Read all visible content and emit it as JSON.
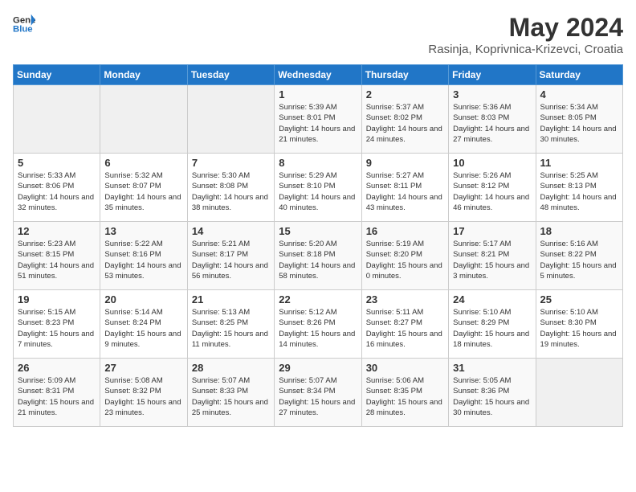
{
  "logo": {
    "general": "General",
    "blue": "Blue"
  },
  "title": "May 2024",
  "subtitle": "Rasinja, Koprivnica-Krizevci, Croatia",
  "days_of_week": [
    "Sunday",
    "Monday",
    "Tuesday",
    "Wednesday",
    "Thursday",
    "Friday",
    "Saturday"
  ],
  "weeks": [
    [
      {
        "day": "",
        "info": ""
      },
      {
        "day": "",
        "info": ""
      },
      {
        "day": "",
        "info": ""
      },
      {
        "day": "1",
        "info": "Sunrise: 5:39 AM\nSunset: 8:01 PM\nDaylight: 14 hours and 21 minutes."
      },
      {
        "day": "2",
        "info": "Sunrise: 5:37 AM\nSunset: 8:02 PM\nDaylight: 14 hours and 24 minutes."
      },
      {
        "day": "3",
        "info": "Sunrise: 5:36 AM\nSunset: 8:03 PM\nDaylight: 14 hours and 27 minutes."
      },
      {
        "day": "4",
        "info": "Sunrise: 5:34 AM\nSunset: 8:05 PM\nDaylight: 14 hours and 30 minutes."
      }
    ],
    [
      {
        "day": "5",
        "info": "Sunrise: 5:33 AM\nSunset: 8:06 PM\nDaylight: 14 hours and 32 minutes."
      },
      {
        "day": "6",
        "info": "Sunrise: 5:32 AM\nSunset: 8:07 PM\nDaylight: 14 hours and 35 minutes."
      },
      {
        "day": "7",
        "info": "Sunrise: 5:30 AM\nSunset: 8:08 PM\nDaylight: 14 hours and 38 minutes."
      },
      {
        "day": "8",
        "info": "Sunrise: 5:29 AM\nSunset: 8:10 PM\nDaylight: 14 hours and 40 minutes."
      },
      {
        "day": "9",
        "info": "Sunrise: 5:27 AM\nSunset: 8:11 PM\nDaylight: 14 hours and 43 minutes."
      },
      {
        "day": "10",
        "info": "Sunrise: 5:26 AM\nSunset: 8:12 PM\nDaylight: 14 hours and 46 minutes."
      },
      {
        "day": "11",
        "info": "Sunrise: 5:25 AM\nSunset: 8:13 PM\nDaylight: 14 hours and 48 minutes."
      }
    ],
    [
      {
        "day": "12",
        "info": "Sunrise: 5:23 AM\nSunset: 8:15 PM\nDaylight: 14 hours and 51 minutes."
      },
      {
        "day": "13",
        "info": "Sunrise: 5:22 AM\nSunset: 8:16 PM\nDaylight: 14 hours and 53 minutes."
      },
      {
        "day": "14",
        "info": "Sunrise: 5:21 AM\nSunset: 8:17 PM\nDaylight: 14 hours and 56 minutes."
      },
      {
        "day": "15",
        "info": "Sunrise: 5:20 AM\nSunset: 8:18 PM\nDaylight: 14 hours and 58 minutes."
      },
      {
        "day": "16",
        "info": "Sunrise: 5:19 AM\nSunset: 8:20 PM\nDaylight: 15 hours and 0 minutes."
      },
      {
        "day": "17",
        "info": "Sunrise: 5:17 AM\nSunset: 8:21 PM\nDaylight: 15 hours and 3 minutes."
      },
      {
        "day": "18",
        "info": "Sunrise: 5:16 AM\nSunset: 8:22 PM\nDaylight: 15 hours and 5 minutes."
      }
    ],
    [
      {
        "day": "19",
        "info": "Sunrise: 5:15 AM\nSunset: 8:23 PM\nDaylight: 15 hours and 7 minutes."
      },
      {
        "day": "20",
        "info": "Sunrise: 5:14 AM\nSunset: 8:24 PM\nDaylight: 15 hours and 9 minutes."
      },
      {
        "day": "21",
        "info": "Sunrise: 5:13 AM\nSunset: 8:25 PM\nDaylight: 15 hours and 11 minutes."
      },
      {
        "day": "22",
        "info": "Sunrise: 5:12 AM\nSunset: 8:26 PM\nDaylight: 15 hours and 14 minutes."
      },
      {
        "day": "23",
        "info": "Sunrise: 5:11 AM\nSunset: 8:27 PM\nDaylight: 15 hours and 16 minutes."
      },
      {
        "day": "24",
        "info": "Sunrise: 5:10 AM\nSunset: 8:29 PM\nDaylight: 15 hours and 18 minutes."
      },
      {
        "day": "25",
        "info": "Sunrise: 5:10 AM\nSunset: 8:30 PM\nDaylight: 15 hours and 19 minutes."
      }
    ],
    [
      {
        "day": "26",
        "info": "Sunrise: 5:09 AM\nSunset: 8:31 PM\nDaylight: 15 hours and 21 minutes."
      },
      {
        "day": "27",
        "info": "Sunrise: 5:08 AM\nSunset: 8:32 PM\nDaylight: 15 hours and 23 minutes."
      },
      {
        "day": "28",
        "info": "Sunrise: 5:07 AM\nSunset: 8:33 PM\nDaylight: 15 hours and 25 minutes."
      },
      {
        "day": "29",
        "info": "Sunrise: 5:07 AM\nSunset: 8:34 PM\nDaylight: 15 hours and 27 minutes."
      },
      {
        "day": "30",
        "info": "Sunrise: 5:06 AM\nSunset: 8:35 PM\nDaylight: 15 hours and 28 minutes."
      },
      {
        "day": "31",
        "info": "Sunrise: 5:05 AM\nSunset: 8:36 PM\nDaylight: 15 hours and 30 minutes."
      },
      {
        "day": "",
        "info": ""
      }
    ]
  ]
}
